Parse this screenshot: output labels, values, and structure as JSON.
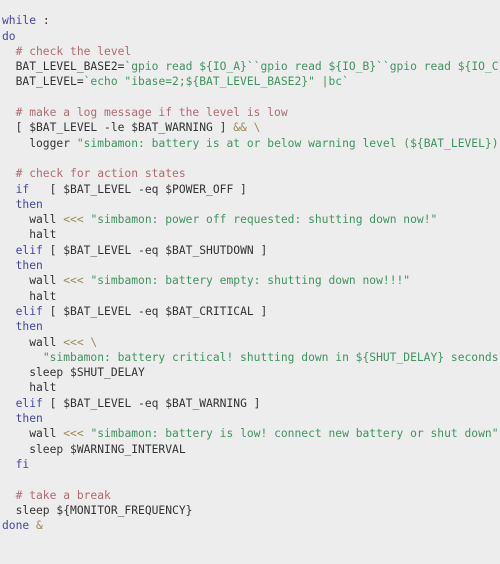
{
  "document": {
    "kind": "source-code-listing",
    "language": "bash",
    "background_color": "#ededed",
    "font_family_kind": "monospace",
    "line_count": 36
  },
  "colors": {
    "background": "#ededed",
    "plain_text": "#333333",
    "keyword": "#4444a8",
    "comment": "#b06a72",
    "string": "#3f9460",
    "operator": "#9a8a55"
  },
  "code": {
    "lines": [
      {
        "n": 1,
        "tokens": [
          {
            "t": "kw",
            "s": "while"
          },
          {
            "t": "pln",
            "s": " :"
          }
        ]
      },
      {
        "n": 2,
        "tokens": [
          {
            "t": "kw",
            "s": "do"
          }
        ]
      },
      {
        "n": 3,
        "tokens": [
          {
            "t": "cmt",
            "s": "  # check the level"
          }
        ]
      },
      {
        "n": 4,
        "tokens": [
          {
            "t": "pln",
            "s": "  BAT_LEVEL_BASE2="
          },
          {
            "t": "str",
            "s": "`gpio read ${IO_A}`"
          },
          {
            "t": "str",
            "s": "`gpio read ${IO_B}`"
          },
          {
            "t": "str",
            "s": "`gpio read ${IO_C}`"
          }
        ]
      },
      {
        "n": 5,
        "tokens": [
          {
            "t": "pln",
            "s": "  BAT_LEVEL="
          },
          {
            "t": "str",
            "s": "`echo \"ibase=2;${BAT_LEVEL_BASE2}\" |bc`"
          }
        ]
      },
      {
        "n": 6,
        "tokens": [
          {
            "t": "pln",
            "s": ""
          }
        ]
      },
      {
        "n": 7,
        "tokens": [
          {
            "t": "cmt",
            "s": "  # make a log message if the level is low"
          }
        ]
      },
      {
        "n": 8,
        "tokens": [
          {
            "t": "pln",
            "s": "  [ $BAT_LEVEL -le $BAT_WARNING ] "
          },
          {
            "t": "op",
            "s": "&& \\"
          }
        ]
      },
      {
        "n": 9,
        "tokens": [
          {
            "t": "pln",
            "s": "    logger "
          },
          {
            "t": "str",
            "s": "\"simbamon: battery is at or below warning level (${BAT_LEVEL})\""
          }
        ]
      },
      {
        "n": 10,
        "tokens": [
          {
            "t": "pln",
            "s": ""
          }
        ]
      },
      {
        "n": 11,
        "tokens": [
          {
            "t": "cmt",
            "s": "  # check for action states"
          }
        ]
      },
      {
        "n": 12,
        "tokens": [
          {
            "t": "pln",
            "s": "  "
          },
          {
            "t": "kw",
            "s": "if"
          },
          {
            "t": "pln",
            "s": "   [ $BAT_LEVEL -eq $POWER_OFF ]"
          }
        ]
      },
      {
        "n": 13,
        "tokens": [
          {
            "t": "pln",
            "s": "  "
          },
          {
            "t": "kw",
            "s": "then"
          }
        ]
      },
      {
        "n": 14,
        "tokens": [
          {
            "t": "pln",
            "s": "    wall "
          },
          {
            "t": "op",
            "s": "<<<"
          },
          {
            "t": "pln",
            "s": " "
          },
          {
            "t": "str",
            "s": "\"simbamon: power off requested: shutting down now!\""
          }
        ]
      },
      {
        "n": 15,
        "tokens": [
          {
            "t": "pln",
            "s": "    halt"
          }
        ]
      },
      {
        "n": 16,
        "tokens": [
          {
            "t": "pln",
            "s": "  "
          },
          {
            "t": "kw",
            "s": "elif"
          },
          {
            "t": "pln",
            "s": " [ $BAT_LEVEL -eq $BAT_SHUTDOWN ]"
          }
        ]
      },
      {
        "n": 17,
        "tokens": [
          {
            "t": "pln",
            "s": "  "
          },
          {
            "t": "kw",
            "s": "then"
          }
        ]
      },
      {
        "n": 18,
        "tokens": [
          {
            "t": "pln",
            "s": "    wall "
          },
          {
            "t": "op",
            "s": "<<<"
          },
          {
            "t": "pln",
            "s": " "
          },
          {
            "t": "str",
            "s": "\"simbamon: battery empty: shutting down now!!!\""
          }
        ]
      },
      {
        "n": 19,
        "tokens": [
          {
            "t": "pln",
            "s": "    halt"
          }
        ]
      },
      {
        "n": 20,
        "tokens": [
          {
            "t": "pln",
            "s": "  "
          },
          {
            "t": "kw",
            "s": "elif"
          },
          {
            "t": "pln",
            "s": " [ $BAT_LEVEL -eq $BAT_CRITICAL ]"
          }
        ]
      },
      {
        "n": 21,
        "tokens": [
          {
            "t": "pln",
            "s": "  "
          },
          {
            "t": "kw",
            "s": "then"
          }
        ]
      },
      {
        "n": 22,
        "tokens": [
          {
            "t": "pln",
            "s": "    wall "
          },
          {
            "t": "op",
            "s": "<<< \\"
          }
        ]
      },
      {
        "n": 23,
        "tokens": [
          {
            "t": "pln",
            "s": "      "
          },
          {
            "t": "str",
            "s": "\"simbamon: battery critical! shutting down in ${SHUT_DELAY} seconds!\""
          }
        ]
      },
      {
        "n": 24,
        "tokens": [
          {
            "t": "pln",
            "s": "    sleep $SHUT_DELAY"
          }
        ]
      },
      {
        "n": 25,
        "tokens": [
          {
            "t": "pln",
            "s": "    halt"
          }
        ]
      },
      {
        "n": 26,
        "tokens": [
          {
            "t": "pln",
            "s": "  "
          },
          {
            "t": "kw",
            "s": "elif"
          },
          {
            "t": "pln",
            "s": " [ $BAT_LEVEL -eq $BAT_WARNING ]"
          }
        ]
      },
      {
        "n": 27,
        "tokens": [
          {
            "t": "pln",
            "s": "  "
          },
          {
            "t": "kw",
            "s": "then"
          }
        ]
      },
      {
        "n": 28,
        "tokens": [
          {
            "t": "pln",
            "s": "    wall "
          },
          {
            "t": "op",
            "s": "<<<"
          },
          {
            "t": "pln",
            "s": " "
          },
          {
            "t": "str",
            "s": "\"simbamon: battery is low! connect new battery or shut down\""
          }
        ]
      },
      {
        "n": 29,
        "tokens": [
          {
            "t": "pln",
            "s": "    sleep $WARNING_INTERVAL"
          }
        ]
      },
      {
        "n": 30,
        "tokens": [
          {
            "t": "pln",
            "s": "  "
          },
          {
            "t": "kw",
            "s": "fi"
          }
        ]
      },
      {
        "n": 31,
        "tokens": [
          {
            "t": "pln",
            "s": ""
          }
        ]
      },
      {
        "n": 32,
        "tokens": [
          {
            "t": "cmt",
            "s": "  # take a break"
          }
        ]
      },
      {
        "n": 33,
        "tokens": [
          {
            "t": "pln",
            "s": "  sleep ${MONITOR_FREQUENCY}"
          }
        ]
      },
      {
        "n": 34,
        "tokens": [
          {
            "t": "kw",
            "s": "done"
          },
          {
            "t": "pln",
            "s": " "
          },
          {
            "t": "op",
            "s": "&"
          }
        ]
      }
    ]
  }
}
